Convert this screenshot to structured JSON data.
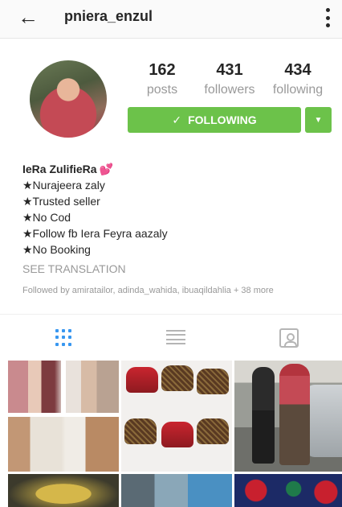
{
  "header": {
    "back_glyph": "←",
    "username": "pniera_enzul"
  },
  "profile": {
    "posts_count": "162",
    "posts_label": "posts",
    "followers_count": "431",
    "followers_label": "followers",
    "following_count": "434",
    "following_label": "following",
    "follow_button_label": "FOLLOWING",
    "follow_check_glyph": "✓",
    "dropdown_glyph": "▼",
    "button_color": "#6cc24a"
  },
  "bio": {
    "full_name": "IeRa ZulifieRa",
    "heart_glyph": "💕",
    "lines": [
      "★Nurajeera zaly",
      "★Trusted seller",
      "★No Cod",
      "★Follow fb Iera Feyra aazaly",
      "★No Booking"
    ],
    "see_translation": "SEE TRANSLATION",
    "followed_by": "Followed by amiratailor, adinda_wahida, ibuaqildahlia + 38 more"
  },
  "tabs": {
    "icons": [
      "grid-icon",
      "list-icon",
      "tagged-icon"
    ],
    "active_color": "#3897f0"
  },
  "icons": {
    "back": "arrow-left-icon",
    "menu": "more-vertical-icon"
  }
}
